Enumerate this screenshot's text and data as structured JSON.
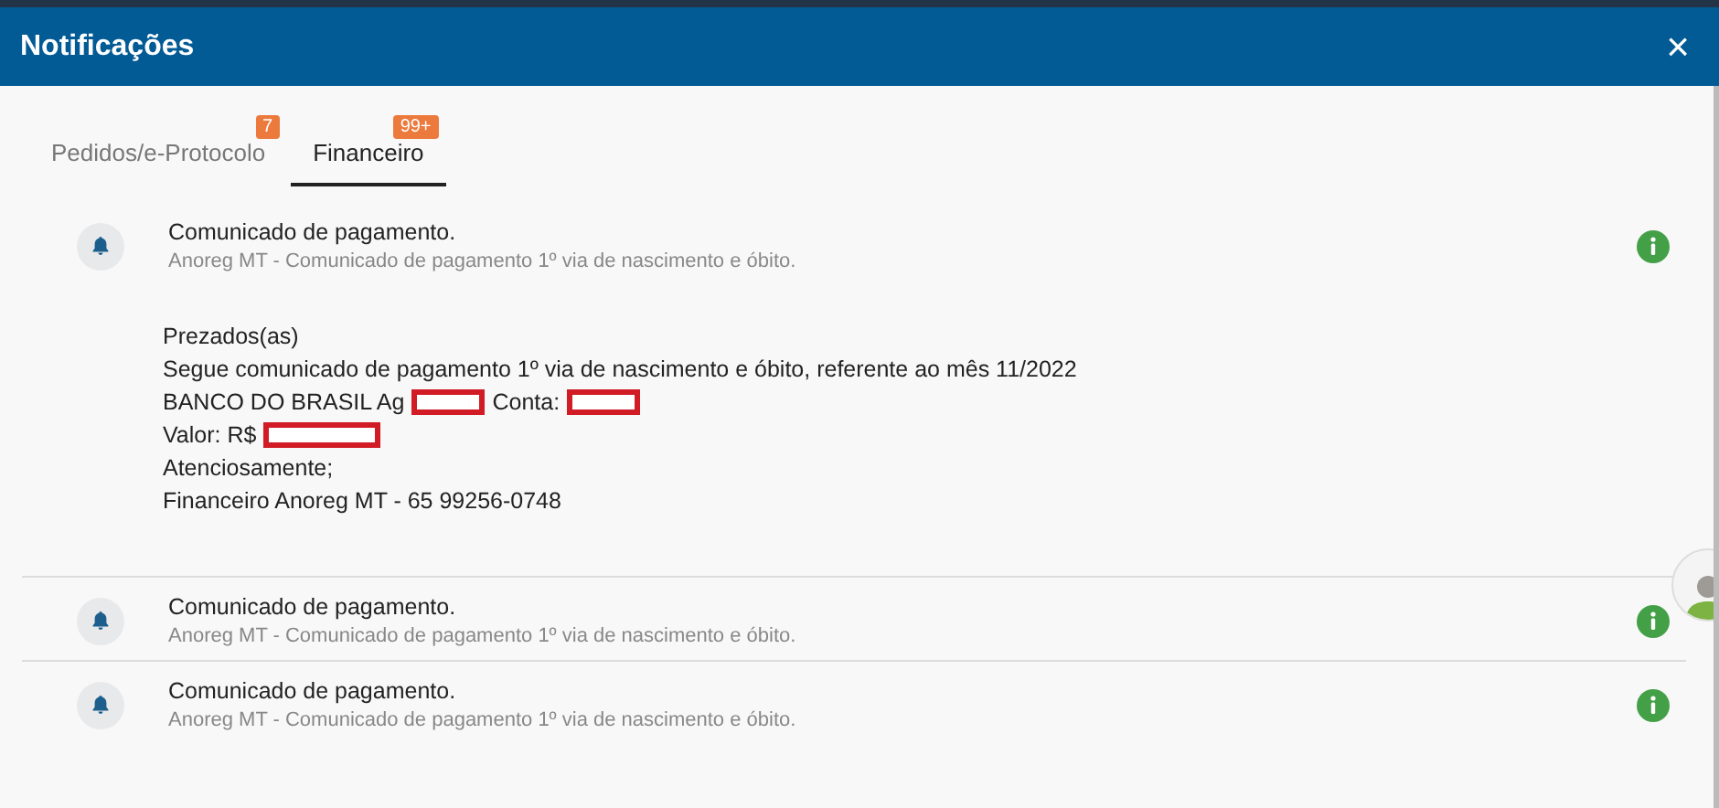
{
  "window": {
    "title": "Notificações",
    "close": "×"
  },
  "tabs": [
    {
      "label": "Pedidos/e-Protocolo",
      "badge": "7",
      "selected": false
    },
    {
      "label": "Financeiro",
      "badge": "99+",
      "selected": true
    }
  ],
  "notifications": [
    {
      "title": "Comunicado de pagamento.",
      "subtitle": "Anoreg MT - Comunicado de pagamento 1º via de nascimento e óbito.",
      "body": [
        [
          {
            "kind": "text",
            "text": "Prezados(as)"
          }
        ],
        [
          {
            "kind": "text",
            "text": "Segue comunicado de pagamento 1º via de nascimento e óbito, referente ao mês 11/2022"
          }
        ],
        [
          {
            "kind": "text",
            "text": "BANCO DO BRASIL Ag"
          },
          {
            "kind": "redacted"
          },
          {
            "kind": "text",
            "text": "Conta:"
          },
          {
            "kind": "redacted"
          }
        ],
        [
          {
            "kind": "text",
            "text": "Valor: R$"
          },
          {
            "kind": "redactedwide"
          }
        ],
        [
          {
            "kind": "text",
            "text": "Atenciosamente;"
          }
        ],
        [
          {
            "kind": "text",
            "text": "Financeiro Anoreg MT - 65 99256-0748"
          }
        ]
      ]
    },
    {
      "title": "Comunicado de pagamento.",
      "subtitle": "Anoreg MT - Comunicado de pagamento 1º via de nascimento e óbito."
    },
    {
      "title": "Comunicado de pagamento.",
      "subtitle": "Anoreg MT - Comunicado de pagamento 1º via de nascimento e óbito."
    }
  ]
}
